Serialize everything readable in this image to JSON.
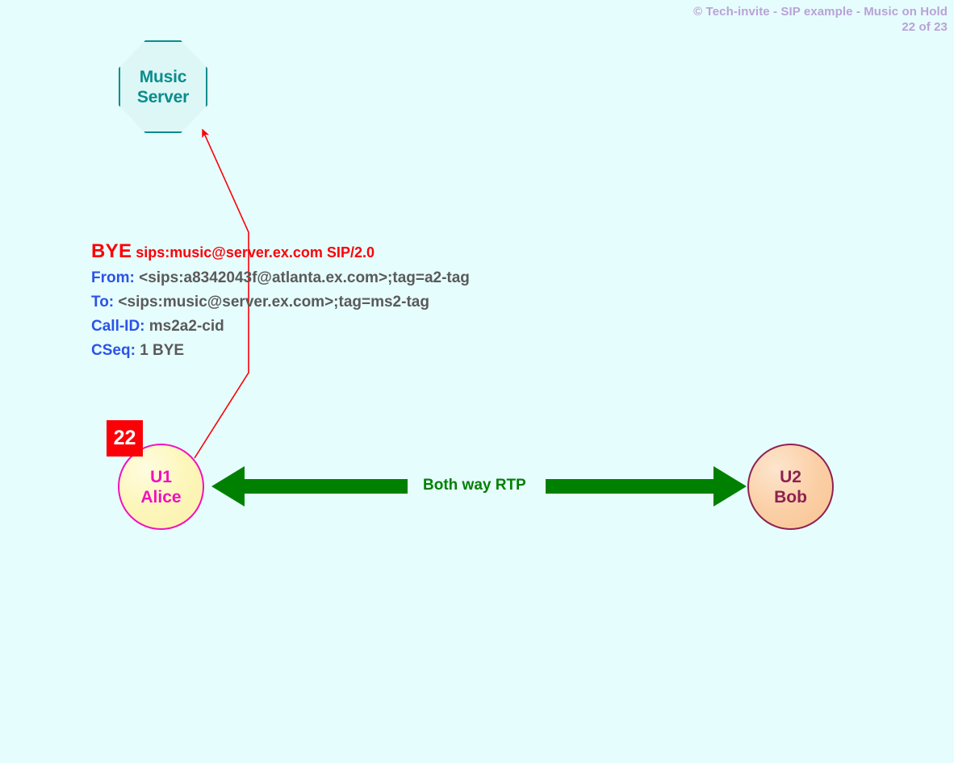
{
  "header": {
    "copyright": "© Tech-invite - SIP example - Music on Hold",
    "page_counter": "22 of 23"
  },
  "nodes": {
    "music_server": {
      "line1": "Music",
      "line2": "Server",
      "shape": "octagon",
      "border_color": "#0b8c8c",
      "fill_color": "#ddf7f7",
      "text_color": "#0b8c8c"
    },
    "alice": {
      "line1": "U1",
      "line2": "Alice",
      "shape": "circle",
      "border_color": "#f012be",
      "text_color": "#f012be"
    },
    "bob": {
      "line1": "U2",
      "line2": "Bob",
      "shape": "circle",
      "border_color": "#8e2151",
      "text_color": "#8e2151"
    }
  },
  "step": {
    "number": "22",
    "badge_color": "#fb0007",
    "badge_text_color": "#ffffff"
  },
  "sip_message": {
    "method": "BYE",
    "request_uri": "sips:music@server.ex.com SIP/2.0",
    "request_line_color": "#fb0007",
    "header_name_color": "#2b53e8",
    "header_value_color": "#5a5a5a",
    "headers": [
      {
        "name": "From:",
        "value": "<sips:a8342043f@atlanta.ex.com>;tag=a2-tag"
      },
      {
        "name": "To:",
        "value": "<sips:music@server.ex.com>;tag=ms2-tag"
      },
      {
        "name": "Call-ID:",
        "value": "ms2a2-cid"
      },
      {
        "name": "CSeq:",
        "value": "1 BYE"
      }
    ]
  },
  "media": {
    "rtp_label": "Both way RTP",
    "rtp_color": "#008000",
    "direction": "bidirectional"
  },
  "signalling": {
    "arrow_color": "#fb0007",
    "from": "alice",
    "to": "music_server"
  }
}
